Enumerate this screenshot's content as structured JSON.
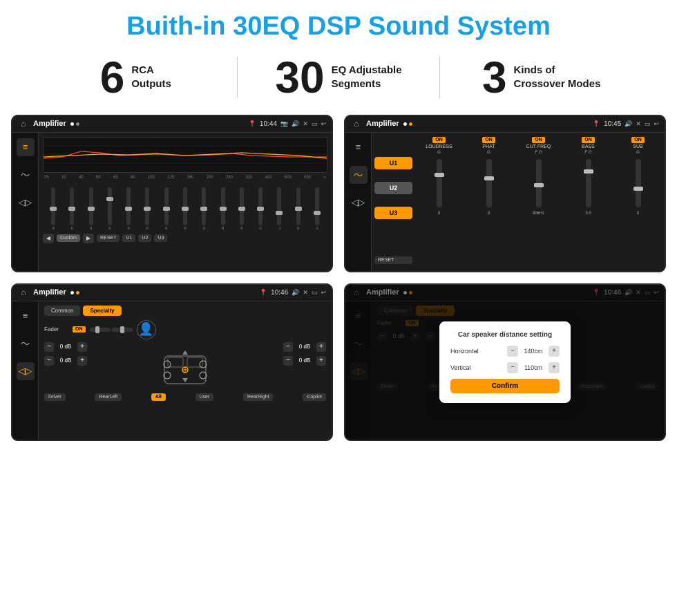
{
  "page": {
    "title": "Buith-in 30EQ DSP Sound System",
    "stats": [
      {
        "number": "6",
        "label": "RCA\nOutputs"
      },
      {
        "number": "30",
        "label": "EQ Adjustable\nSegments"
      },
      {
        "number": "3",
        "label": "Kinds of\nCrossover Modes"
      }
    ],
    "screens": [
      {
        "id": "eq-screen",
        "status_title": "Amplifier",
        "status_time": "10:44",
        "type": "eq"
      },
      {
        "id": "crossover-screen",
        "status_title": "Amplifier",
        "status_time": "10:45",
        "type": "crossover"
      },
      {
        "id": "fader-screen",
        "status_title": "Amplifier",
        "status_time": "10:46",
        "type": "fader"
      },
      {
        "id": "dialog-screen",
        "status_title": "Amplifier",
        "status_time": "10:46",
        "type": "dialog",
        "dialog": {
          "title": "Car speaker distance setting",
          "horizontal_label": "Horizontal",
          "horizontal_value": "140cm",
          "vertical_label": "Vertical",
          "vertical_value": "110cm",
          "confirm_label": "Confirm"
        }
      }
    ],
    "eq_freqs": [
      "25",
      "32",
      "40",
      "50",
      "63",
      "80",
      "100",
      "125",
      "160",
      "200",
      "250",
      "320",
      "400",
      "500",
      "630"
    ],
    "eq_values": [
      "0",
      "0",
      "0",
      "5",
      "0",
      "0",
      "0",
      "0",
      "0",
      "0",
      "0",
      "0",
      "-1",
      "0",
      "-1"
    ],
    "eq_buttons": [
      "Custom",
      "RESET",
      "U1",
      "U2",
      "U3"
    ],
    "cross_cols": [
      {
        "name": "LOUDNESS",
        "on": true,
        "val": "G"
      },
      {
        "name": "PHAT",
        "on": true,
        "val": "G"
      },
      {
        "name": "CUT FREQ",
        "on": true,
        "val": "F"
      },
      {
        "name": "BASS",
        "on": true,
        "val": "G"
      },
      {
        "name": "SUB",
        "on": true,
        "val": "G"
      }
    ],
    "fader_tabs": [
      "Common",
      "Specialty"
    ],
    "fader_active": "Specialty",
    "fader_label": "Fader",
    "bottom_labels": [
      "Driver",
      "RearLeft",
      "All",
      "User",
      "RearRight",
      "Copilot"
    ],
    "db_values": [
      "0 dB",
      "0 dB",
      "0 dB",
      "0 dB"
    ]
  }
}
